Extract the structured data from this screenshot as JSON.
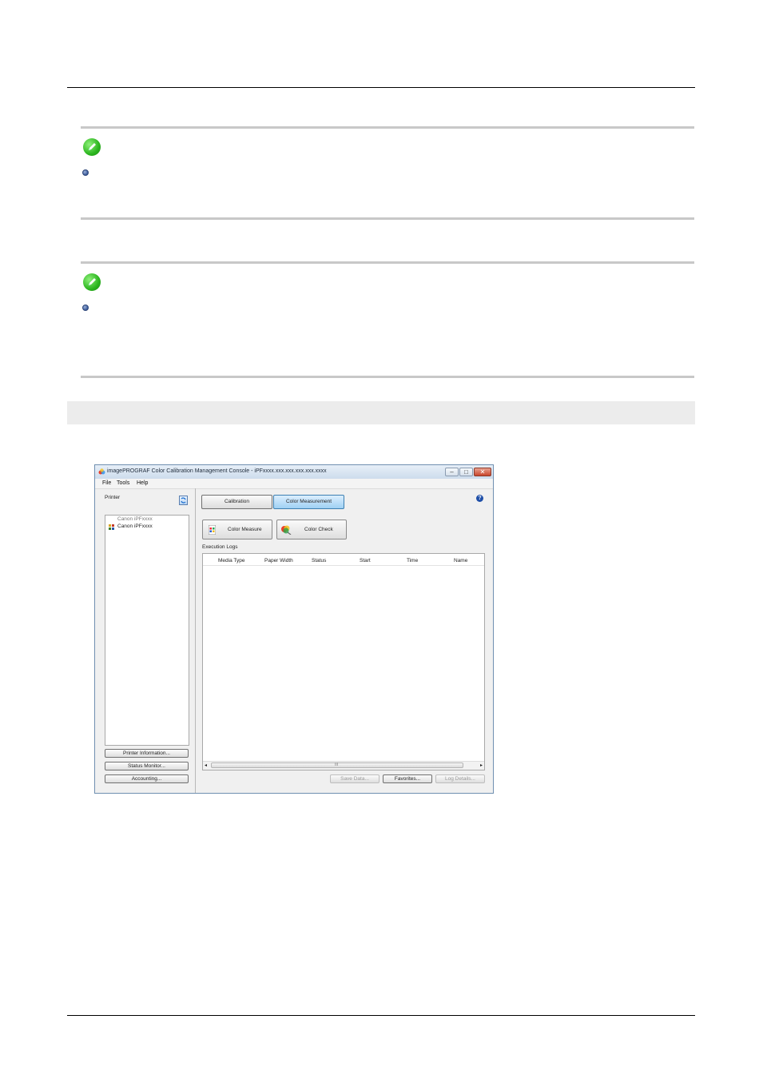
{
  "window": {
    "title": "imagePROGRAF Color Calibration Management Console - iPFxxxx.xxx.xxx.xxx.xxx.xxxx",
    "controls": {
      "minimize": "–",
      "maximize": "□",
      "close": "✕"
    },
    "menu": [
      "File",
      "Tools",
      "Help"
    ],
    "printer_panel": {
      "label": "Printer",
      "tree": {
        "group": "Canon iPFxxxx",
        "item": "Canon iPFxxxx"
      },
      "buttons": [
        "Printer Information...",
        "Status Monitor...",
        "Accounting..."
      ]
    },
    "tabs": {
      "calibration": "Calibration",
      "color_measurement": "Color Measurement",
      "active": "color_measurement"
    },
    "actions": {
      "color_measure": "Color Measure",
      "color_check": "Color Check"
    },
    "execution_logs": {
      "label": "Execution Logs",
      "columns": [
        "Media Type",
        "Paper Width",
        "Status",
        "Start",
        "Time",
        "Name"
      ],
      "scroll_marker": "III"
    },
    "footer_buttons": {
      "save_data": "Save Data...",
      "favorites": "Favorites...",
      "log_details": "Log Details..."
    },
    "help_icon": "?"
  },
  "colors": {
    "note_green": "#2bb51e",
    "rule_gray": "#c8c8c8",
    "band_gray": "#ececec",
    "active_tab": "#9fd0f3"
  },
  "icons": [
    "note-pencil-icon",
    "bullet-icon",
    "app-logo-icon",
    "refresh-icon",
    "printer-grid-icon",
    "color-measure-icon",
    "color-check-icon",
    "help-icon"
  ]
}
